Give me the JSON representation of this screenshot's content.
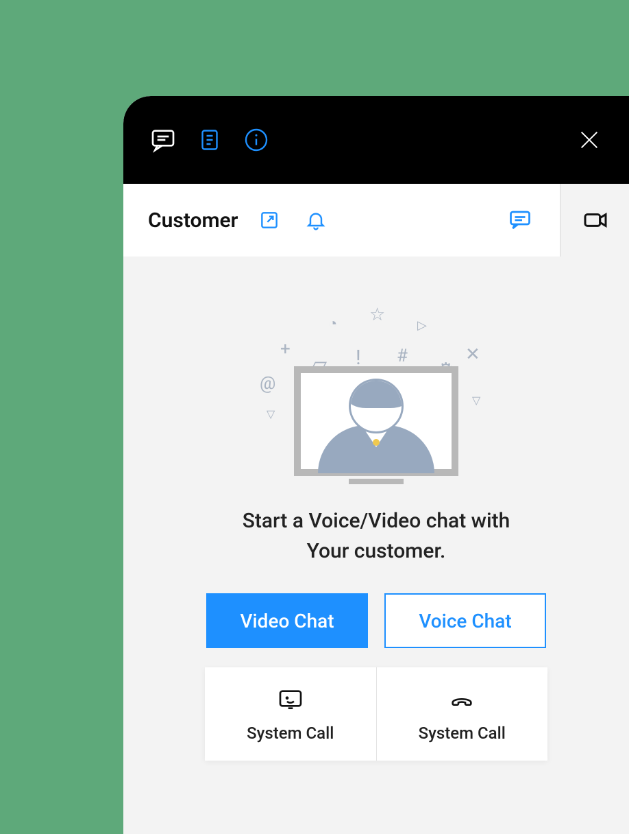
{
  "subheader": {
    "title": "Customer"
  },
  "content": {
    "message_line1": "Start a Voice/Video chat with",
    "message_line2": "Your customer."
  },
  "buttons": {
    "video_chat": "Video Chat",
    "voice_chat": "Voice Chat"
  },
  "cards": {
    "system_call_1": "System Call",
    "system_call_2": "System Call"
  }
}
